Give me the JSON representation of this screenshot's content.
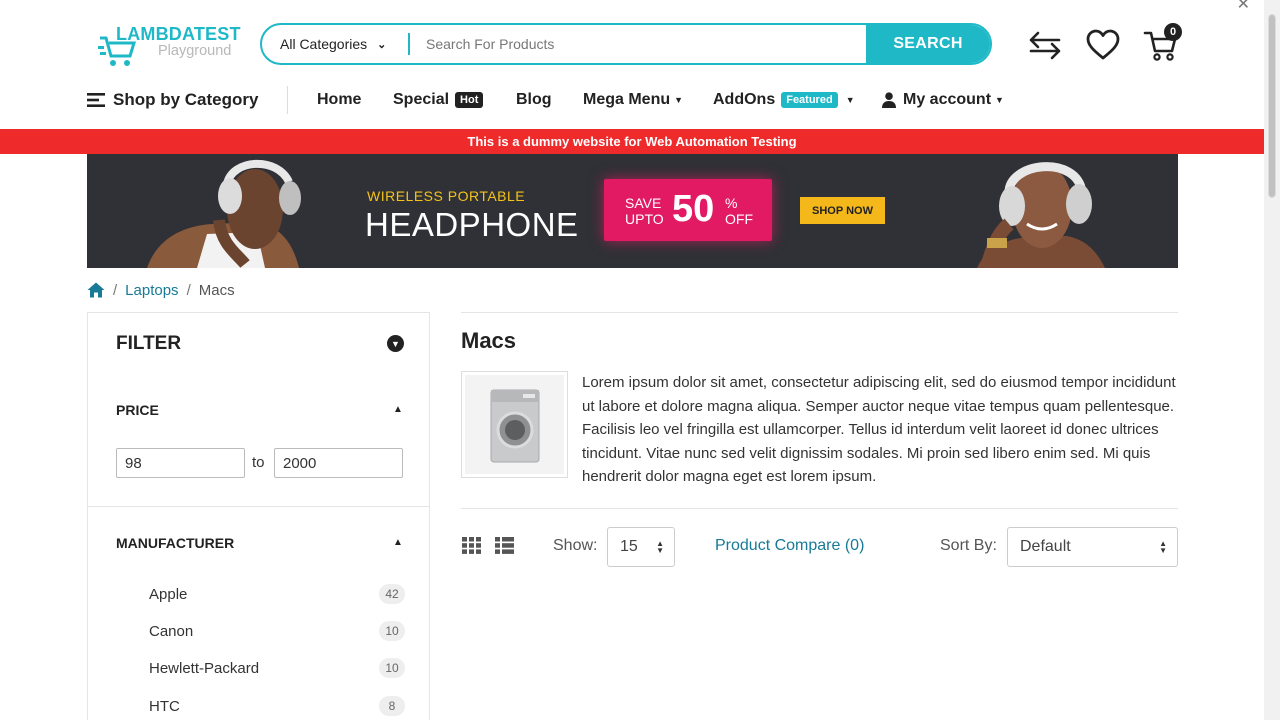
{
  "header": {
    "logo_name": "LAMBDATEST",
    "logo_sub": "Playground",
    "category_label": "All Categories",
    "search_placeholder": "Search For Products",
    "search_button": "SEARCH",
    "cart_count": "0"
  },
  "nav": {
    "shop_by_category": "Shop by Category",
    "home": "Home",
    "special": "Special",
    "special_tag": "Hot",
    "blog": "Blog",
    "mega_menu": "Mega Menu",
    "addons": "AddOns",
    "addons_tag": "Featured",
    "my_account": "My account"
  },
  "notice": "This is a dummy website for Web Automation Testing",
  "banner": {
    "line1": "WIRELESS PORTABLE",
    "line2": "HEADPHONE",
    "save": "SAVE",
    "upto": "UPTO",
    "percent": "50",
    "pct_sign": "%",
    "off": "OFF",
    "cta": "SHOP NOW"
  },
  "breadcrumb": {
    "items": [
      "Laptops"
    ],
    "current": "Macs"
  },
  "filter": {
    "title": "FILTER",
    "price_label": "PRICE",
    "price_min": "98",
    "price_to": "to",
    "price_max": "2000",
    "manufacturer_label": "MANUFACTURER",
    "manufacturers": [
      {
        "name": "Apple",
        "count": "42"
      },
      {
        "name": "Canon",
        "count": "10"
      },
      {
        "name": "Hewlett-Packard",
        "count": "10"
      },
      {
        "name": "HTC",
        "count": "8"
      }
    ]
  },
  "category": {
    "title": "Macs",
    "description": "Lorem ipsum dolor sit amet, consectetur adipiscing elit, sed do eiusmod tempor incididunt ut labore et dolore magna aliqua. Semper auctor neque vitae tempus quam pellentesque. Facilisis leo vel fringilla est ullamcorper. Tellus id interdum velit laoreet id donec ultrices tincidunt. Vitae nunc sed velit dignissim sodales. Mi proin sed libero enim sed. Mi quis hendrerit dolor magna eget est lorem ipsum."
  },
  "toolbar": {
    "show_label": "Show:",
    "show_value": "15",
    "compare": "Product Compare (0)",
    "sort_label": "Sort By:",
    "sort_value": "Default"
  },
  "colors": {
    "accent": "#1fb8c7",
    "notice_bg": "#ee2a2a",
    "link": "#187a96",
    "banner_bg": "#2f3136",
    "sale_pink": "#e11a63",
    "cta_yellow": "#f4b81b"
  }
}
